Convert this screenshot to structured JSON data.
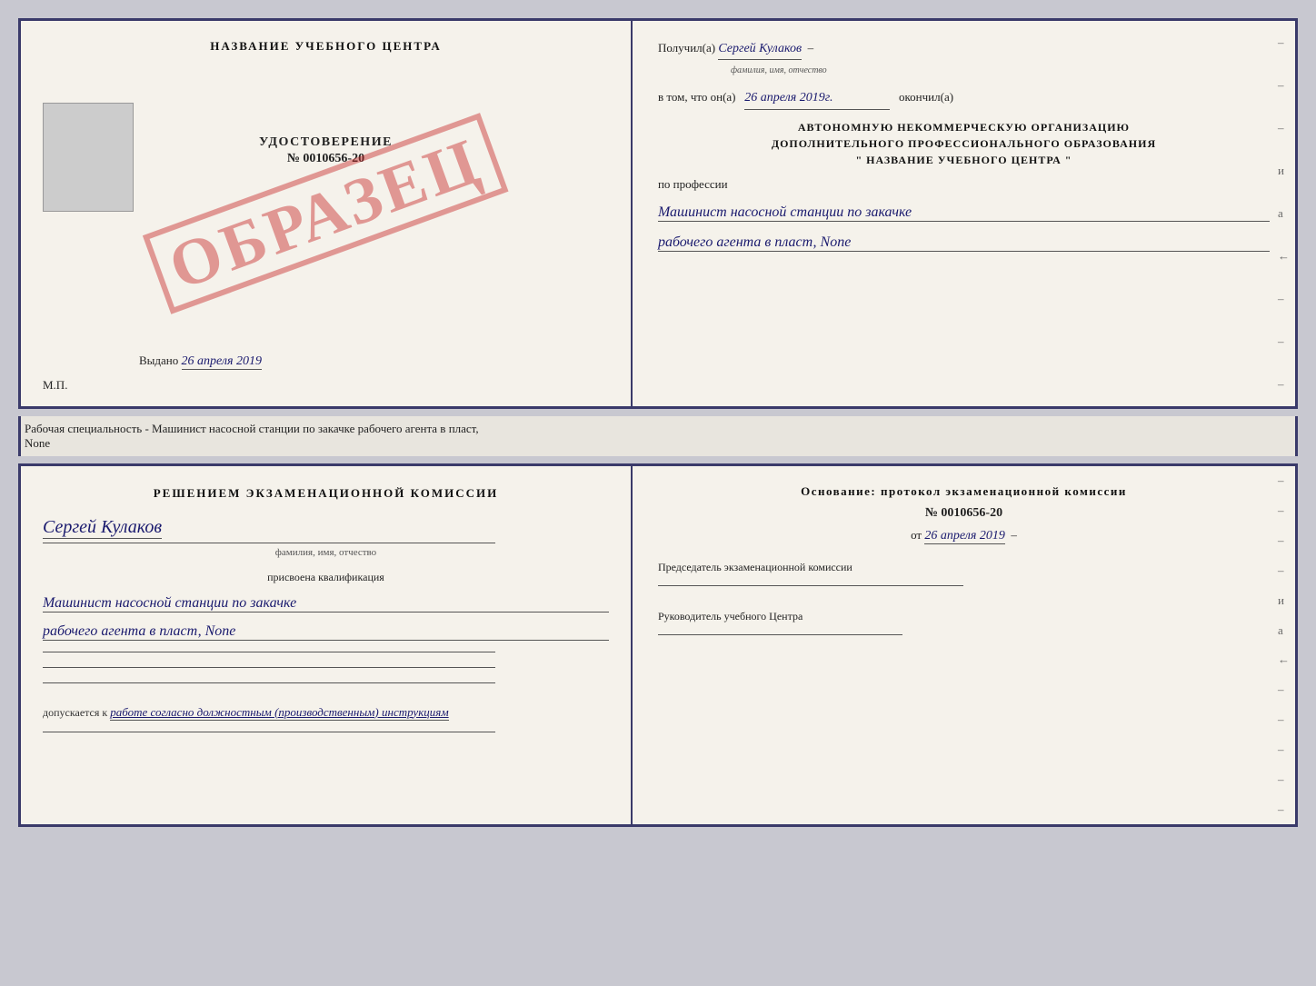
{
  "top_doc": {
    "left": {
      "title": "НАЗВАНИЕ УЧЕБНОГО ЦЕНТРА",
      "stamp": "ОБРАЗЕЦ",
      "udostoverenie_label": "УДОСТОВЕРЕНИЕ",
      "udostoverenie_num": "№ 0010656-20",
      "vydano_label": "Выдано",
      "vydano_date": "26 апреля 2019",
      "mp_label": "М.П."
    },
    "right": {
      "poluchil_label": "Получил(а)",
      "poluchil_value": "Сергей Кулаков",
      "familiya_hint": "фамилия, имя, отчество",
      "v_tom_label": "в том, что он(а)",
      "v_tom_date": "26 апреля 2019г.",
      "okonchil_label": "окончил(а)",
      "org_line1": "АВТОНОМНУЮ НЕКОММЕРЧЕСКУЮ ОРГАНИЗАЦИЮ",
      "org_line2": "ДОПОЛНИТЕЛЬНОГО ПРОФЕССИОНАЛЬНОГО ОБРАЗОВАНИЯ",
      "org_line3": "\" НАЗВАНИЕ УЧЕБНОГО ЦЕНТРА \"",
      "po_professii": "по профессии",
      "profession_line1": "Машинист насосной станции по закачке",
      "profession_line2": "рабочего агента в пласт, None",
      "dashes": [
        "-",
        "-",
        "-",
        "и",
        "а",
        "←",
        "-",
        "-",
        "-"
      ]
    }
  },
  "separator": {
    "text": "Рабочая специальность - Машинист насосной станции по закачке рабочего агента в пласт,",
    "text2": "None"
  },
  "bottom_doc": {
    "left": {
      "resheniyem_label": "Решением экзаменационной комиссии",
      "person_name": "Сергей Кулаков",
      "familiya_hint": "фамилия, имя, отчество",
      "prisvoena_label": "присвоена квалификация",
      "profession_line1": "Машинист насосной станции по закачке",
      "profession_line2": "рабочего агента в пласт, None",
      "dopuskaetsya_label": "допускается к",
      "dopuskaetsya_value": "работе согласно должностным (производственным) инструкциям"
    },
    "right": {
      "osnovanie_label": "Основание: протокол экзаменационной комиссии",
      "protocol_num": "№ 0010656-20",
      "ot_label": "от",
      "ot_date": "26 апреля 2019",
      "predsedatel_label": "Председатель экзаменационной комиссии",
      "rukovoditel_label": "Руководитель учебного Центра",
      "dashes": [
        "-",
        "-",
        "-",
        "-",
        "и",
        "а",
        "←",
        "-",
        "-",
        "-",
        "-",
        "-"
      ]
    }
  }
}
